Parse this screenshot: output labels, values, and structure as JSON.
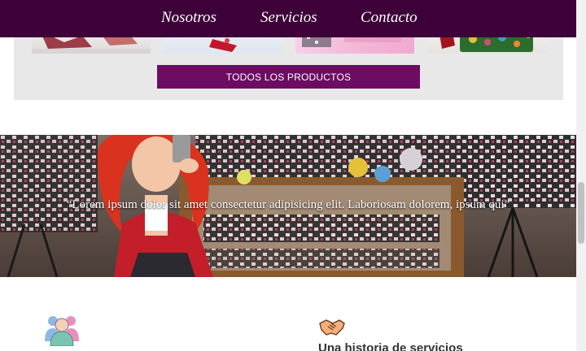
{
  "nav": {
    "links": [
      "Nosotros",
      "Servicios",
      "Contacto"
    ]
  },
  "products": {
    "button_label": "TODOS LOS PRODUCTOS"
  },
  "banner": {
    "quote": "“Lorem ipsum dolor sit amet consectetur adipisicing elit. Laboriosam dolorem, ipsum qui”"
  },
  "features": [
    {
      "icon": "team-icon",
      "title": ""
    },
    {
      "icon": "handshake-icon",
      "title": "Una historia de servicios"
    }
  ],
  "colors": {
    "navbar": "#3d0039",
    "button": "#6c0c63",
    "section_bg": "#e9e8e8"
  }
}
